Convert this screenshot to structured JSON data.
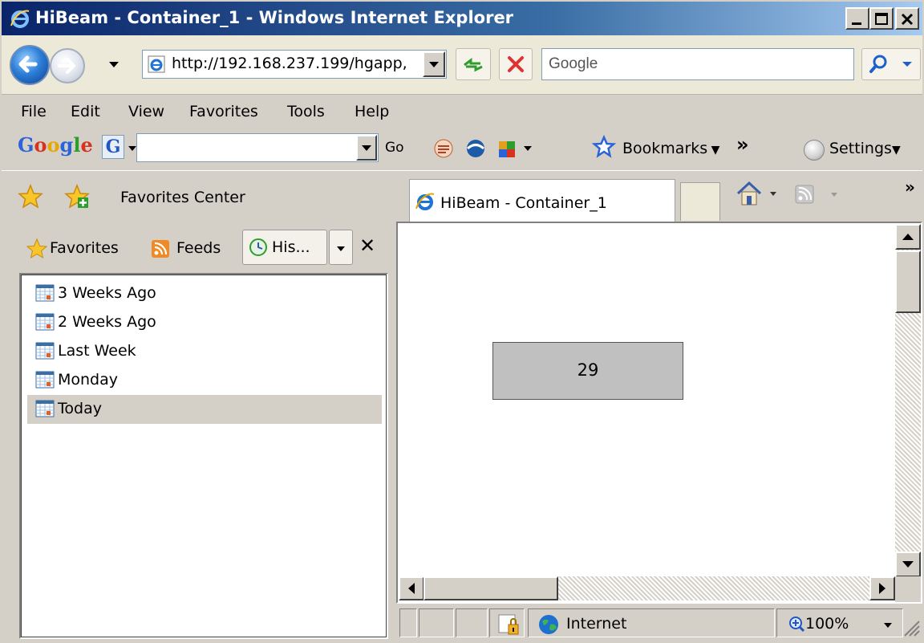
{
  "window": {
    "title": "HiBeam - Container_1 - Windows Internet Explorer"
  },
  "address_bar": {
    "url": "http://192.168.237.199/hgapp,"
  },
  "search": {
    "placeholder": "Google"
  },
  "menu": {
    "items": [
      "File",
      "Edit",
      "View",
      "Favorites",
      "Tools",
      "Help"
    ]
  },
  "google_toolbar": {
    "logo": "Google",
    "g_button": "G",
    "go_label": "Go",
    "bookmarks_label": "Bookmarks",
    "chevron": "»",
    "settings_label": "Settings"
  },
  "tabs": {
    "favorites_center_label": "Favorites Center",
    "active_tab_label": "HiBeam - Container_1",
    "overflow_chevron": "»"
  },
  "favorites_pane": {
    "favorites_tab": "Favorites",
    "feeds_tab": "Feeds",
    "history_tab": "His...",
    "close_glyph": "✕",
    "history_items": [
      {
        "label": "3 Weeks Ago",
        "selected": false
      },
      {
        "label": "2 Weeks Ago",
        "selected": false
      },
      {
        "label": "Last Week",
        "selected": false
      },
      {
        "label": "Monday",
        "selected": false
      },
      {
        "label": "Today",
        "selected": true
      }
    ]
  },
  "content": {
    "value": "29"
  },
  "status_bar": {
    "zone": "Internet",
    "zoom": "100%"
  },
  "colors": {
    "title_gradient_start": "#0a246a",
    "title_gradient_end": "#a6caf0",
    "chrome": "#d4d0c8",
    "toolbar": "#ece9d8",
    "value_box": "#c0c0c0"
  }
}
